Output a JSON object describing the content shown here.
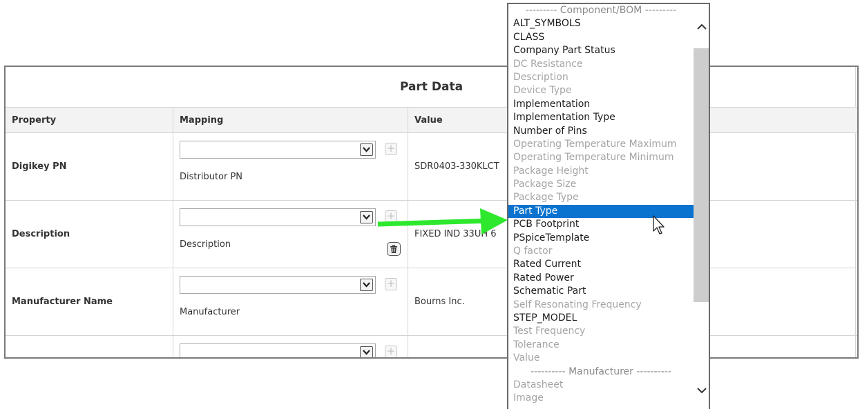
{
  "panel": {
    "title": "Part Data",
    "columns": {
      "property": "Property",
      "mapping": "Mapping",
      "value": "Value"
    },
    "rows": [
      {
        "property": "Digikey PN",
        "mapping_label": "Distributor PN",
        "value": "SDR0403-330KLCT"
      },
      {
        "property": "Description",
        "mapping_label": "Description",
        "value": "FIXED IND 33UH 6"
      },
      {
        "property": "Manufacturer Name",
        "mapping_label": "Manufacturer",
        "value": "Bourns Inc."
      }
    ],
    "plus_glyph": "+"
  },
  "dropdown": {
    "options": [
      {
        "label": "--------- Component/BOM ---------",
        "kind": "sep"
      },
      {
        "label": "ALT_SYMBOLS",
        "kind": "normal"
      },
      {
        "label": "CLASS",
        "kind": "normal"
      },
      {
        "label": "Company Part Status",
        "kind": "normal"
      },
      {
        "label": "DC Resistance",
        "kind": "muted"
      },
      {
        "label": "Description",
        "kind": "muted"
      },
      {
        "label": "Device Type",
        "kind": "muted"
      },
      {
        "label": "Implementation",
        "kind": "normal"
      },
      {
        "label": "Implementation Type",
        "kind": "normal"
      },
      {
        "label": "Number of Pins",
        "kind": "normal"
      },
      {
        "label": "Operating Temperature Maximum",
        "kind": "muted"
      },
      {
        "label": "Operating Temperature Minimum",
        "kind": "muted"
      },
      {
        "label": "Package Height",
        "kind": "muted"
      },
      {
        "label": "Package Size",
        "kind": "muted"
      },
      {
        "label": "Package Type",
        "kind": "muted"
      },
      {
        "label": "Part Type",
        "kind": "selected"
      },
      {
        "label": "PCB Footprint",
        "kind": "normal"
      },
      {
        "label": "PSpiceTemplate",
        "kind": "normal"
      },
      {
        "label": "Q factor",
        "kind": "muted"
      },
      {
        "label": "Rated Current",
        "kind": "normal"
      },
      {
        "label": "Rated Power",
        "kind": "normal"
      },
      {
        "label": "Schematic Part",
        "kind": "normal"
      },
      {
        "label": "Self Resonating Frequency",
        "kind": "muted"
      },
      {
        "label": "STEP_MODEL",
        "kind": "normal"
      },
      {
        "label": "Test Frequency",
        "kind": "muted"
      },
      {
        "label": "Tolerance",
        "kind": "muted"
      },
      {
        "label": "Value",
        "kind": "muted"
      },
      {
        "label": "---------- Manufacturer ----------",
        "kind": "sep"
      },
      {
        "label": "Datasheet",
        "kind": "muted"
      },
      {
        "label": "Image",
        "kind": "muted"
      }
    ]
  },
  "colors": {
    "selected_bg": "#0a73cf",
    "arrow": "#2ee82e",
    "muted_text": "#a5a5a5",
    "border": "#7a7a7a"
  },
  "icons": {
    "dropdown": "chevron-down-icon",
    "add": "plus-icon",
    "delete": "trash-icon",
    "scroll_up": "chevron-up-icon",
    "scroll_down": "chevron-down-icon",
    "pointer": "mouse-cursor-icon",
    "annotation": "green-arrow-icon"
  }
}
